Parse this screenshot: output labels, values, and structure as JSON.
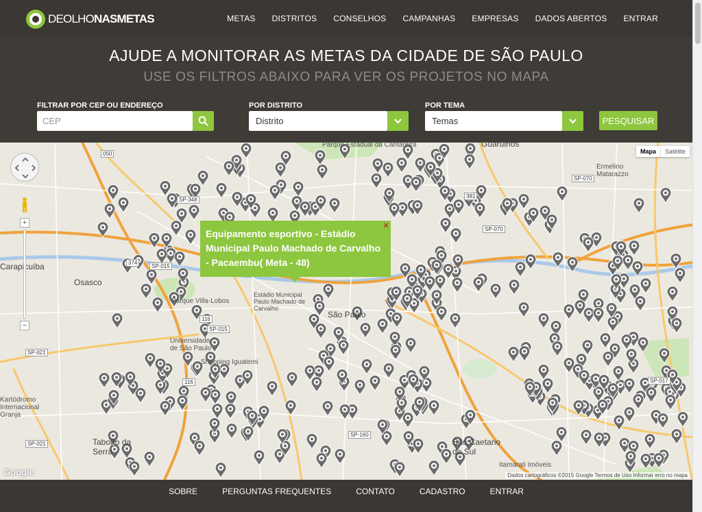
{
  "brand": {
    "name_light": "DEOLHO",
    "name_bold": "NASMETAS"
  },
  "nav": {
    "items": [
      "METAS",
      "DISTRITOS",
      "CONSELHOS",
      "CAMPANHAS",
      "EMPRESAS",
      "DADOS ABERTOS",
      "ENTRAR"
    ]
  },
  "hero": {
    "title": "AJUDE A MONITORAR AS METAS DA CIDADE DE SÃO PAULO",
    "subtitle": "USE OS FILTROS ABAIXO PARA VER OS PROJETOS NO MAPA"
  },
  "filters": {
    "cep_label": "FILTRAR POR CEP OU ENDEREÇO",
    "cep_placeholder": "CEP",
    "distrito_label": "POR DISTRITO",
    "distrito_value": "Distrito",
    "tema_label": "POR TEMA",
    "tema_value": "Temas",
    "search_label": "PESQUISAR"
  },
  "map": {
    "maptype": {
      "map": "Mapa",
      "satellite": "Satélite"
    },
    "infowindow": "Equipamento esportivo - Estádio Municipal Paulo Machado de Carvalho - Pacaembu( Meta - 48)",
    "attribution": "Dados cartográficos ©2015 Google    Termos de Uso    Informar erro no mapa",
    "google": "Google",
    "labels": {
      "guarulhos": "Guarulhos",
      "osasco": "Osasco",
      "sao_paulo": "São Paulo",
      "sao_caetano": "São Caetano do Sul",
      "taboao": "Taboão da Serra",
      "carapicuiba": "Carapicuíba",
      "villa_lobos": "Parque Villa-Lobos",
      "usp": "Universidade de São Paulo",
      "iguatemi": "Shopping Iguatemi",
      "estadio": "Estádio Municipal Paulo Machado de Carvalho",
      "ermelino": "Ermelino Matarazzo",
      "itamarati": "Itamarati Imóveis",
      "kartodromo": "Kartódromo Internacional Granja",
      "cantareira": "Parque Estadual da Cantareira"
    },
    "roads": [
      "SP-070",
      "SP-015",
      "SP-021",
      "SP-160",
      "SP-348",
      "116",
      "374",
      "050",
      "381",
      "SP-017"
    ],
    "pin_count": 430,
    "accent_color": "#8dc63f",
    "pin_color": "#6b6b6b"
  },
  "footer": {
    "links": [
      "SOBRE",
      "PERGUNTAS FREQUENTES",
      "CONTATO",
      "CADASTRO",
      "ENTRAR"
    ]
  }
}
